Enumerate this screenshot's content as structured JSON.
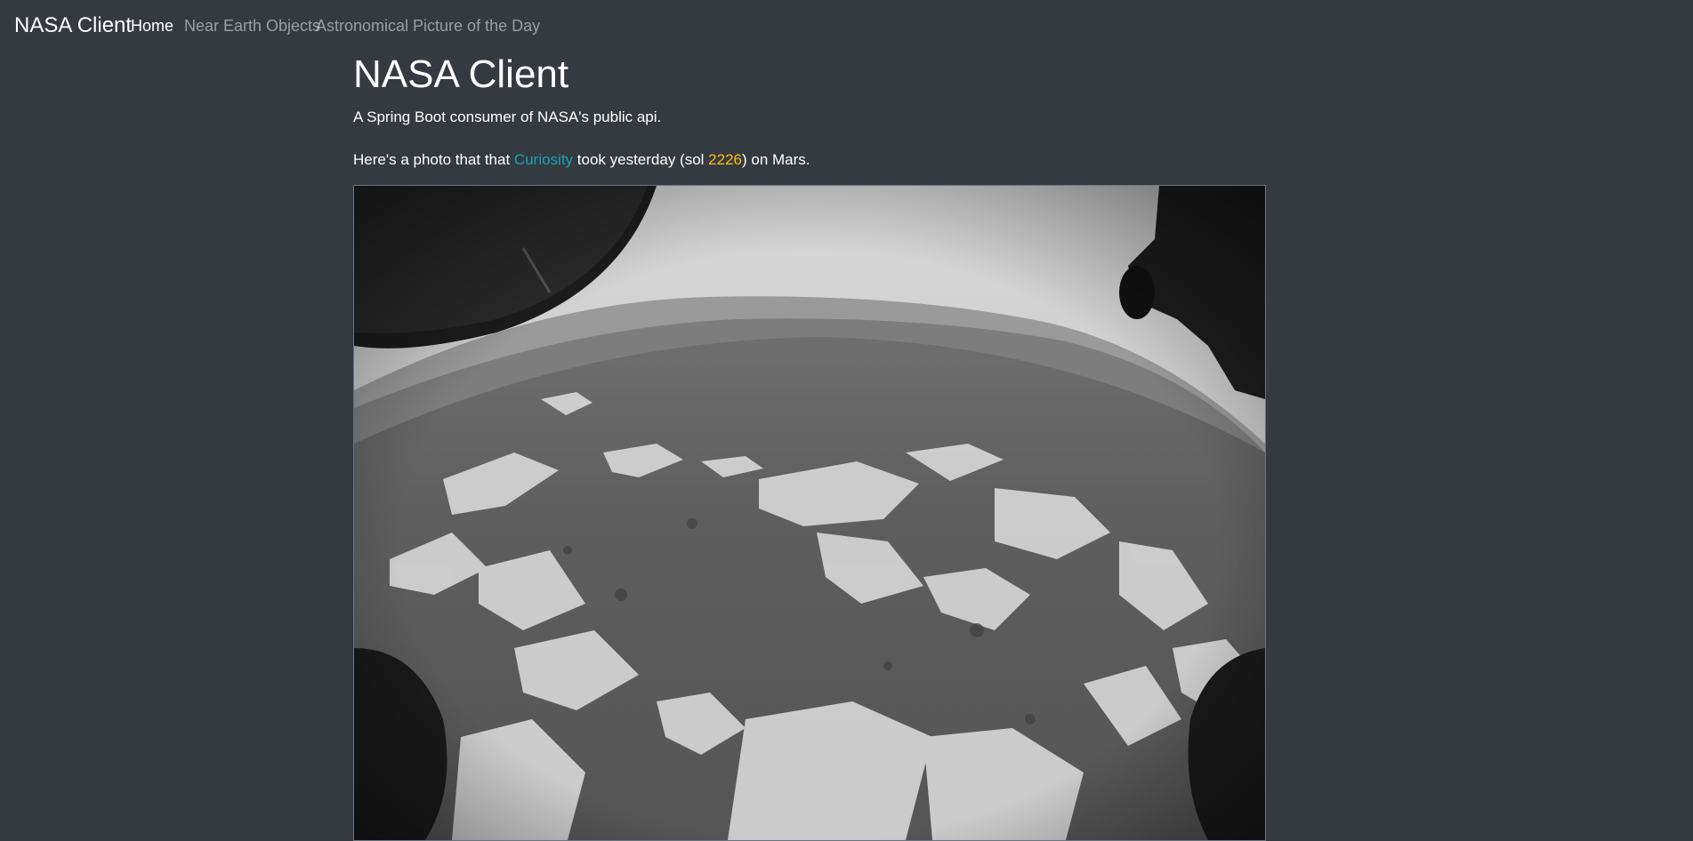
{
  "navbar": {
    "brand": "NASA Client",
    "links": [
      {
        "label": "Home",
        "active": true
      },
      {
        "label": "Near Earth Objects",
        "active": false
      },
      {
        "label": "Astronomical Picture of the Day",
        "active": false
      }
    ]
  },
  "main": {
    "title": "NASA Client",
    "lead": "A Spring Boot consumer of NASA's public api.",
    "photo_intro": {
      "prefix": "Here's a photo that that ",
      "rover": "Curiosity",
      "middle": " took yesterday (sol ",
      "sol": "2226",
      "suffix": ") on Mars."
    },
    "photo_alt": "Mars rover hazcam photo"
  },
  "colors": {
    "background": "#343a40",
    "rover_link": "#17a2b8",
    "sol_number": "#ffc107"
  }
}
